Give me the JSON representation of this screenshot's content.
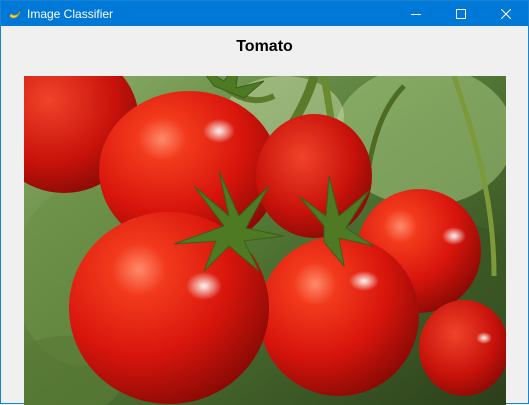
{
  "window": {
    "title": "Image Classifier",
    "icon": "app-banana-icon",
    "controls": [
      "minimize-icon",
      "maximize-icon",
      "close-icon"
    ]
  },
  "result": {
    "label": "Tomato"
  },
  "image": {
    "subject": "tomato-photo"
  },
  "colors": {
    "titlebar": "#0078d7",
    "background": "#f0f0f0",
    "tomato_red": "#e0190f",
    "leaf_green": "#4d7a2a"
  }
}
